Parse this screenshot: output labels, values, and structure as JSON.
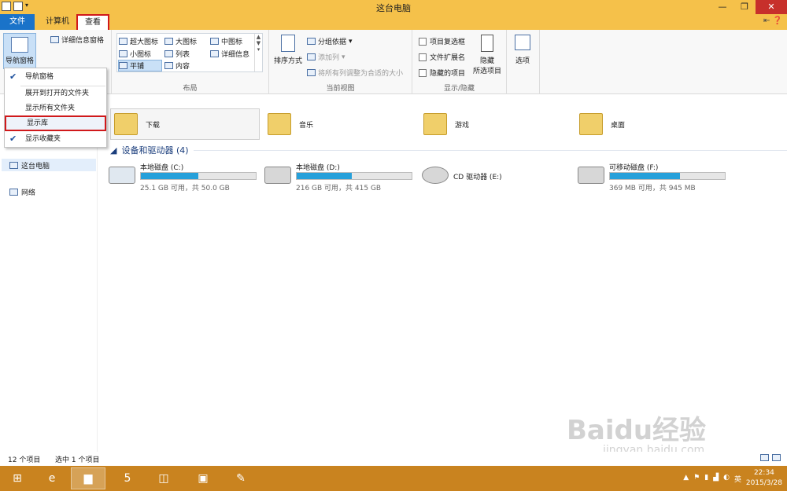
{
  "window": {
    "title": "这台电脑",
    "minimize": "—",
    "maximize": "❐",
    "close": "✕"
  },
  "tabs": {
    "file": "文件",
    "computer": "计算机",
    "view": "查看"
  },
  "ribbon": {
    "nav_pane": "导航窗格",
    "detail_pane": "详细信息窗格",
    "layout": {
      "xl_icons": "超大图标",
      "large_icons": "大图标",
      "medium_icons": "中图标",
      "small_icons": "小图标",
      "list": "列表",
      "details": "详细信息",
      "tiles": "平铺",
      "content": "内容",
      "group_label": "布局"
    },
    "current_view": {
      "sort": "排序方式",
      "group_by": "分组依据",
      "add_column": "添加列",
      "fit_columns": "将所有列调整为合适的大小",
      "group_label": "当前视图"
    },
    "show_hide": {
      "item_checkboxes": "项目复选框",
      "file_ext": "文件扩展名",
      "hidden_items": "隐藏的项目",
      "hide_selected_1": "隐藏",
      "hide_selected_2": "所选项目",
      "group_label": "显示/隐藏"
    },
    "options": "选项"
  },
  "dropdown": {
    "items": [
      "导航窗格",
      "展开到打开的文件夹",
      "显示所有文件夹",
      "显示库",
      "显示收藏夹"
    ]
  },
  "nav": {
    "this_pc": "这台电脑",
    "network": "网络"
  },
  "folders": [
    "下载",
    "音乐",
    "游戏",
    "桌面"
  ],
  "devices": {
    "section": "设备和驱动器 (4)",
    "drives": [
      {
        "name": "本地磁盘 (C:)",
        "space": "25.1 GB 可用，共 50.0 GB",
        "used": 0.5
      },
      {
        "name": "本地磁盘 (D:)",
        "space": "216 GB 可用，共 415 GB",
        "used": 0.48
      },
      {
        "name": "CD 驱动器 (E:)",
        "space": "",
        "used": 0
      },
      {
        "name": "可移动磁盘 (F:)",
        "space": "369 MB 可用，共 945 MB",
        "used": 0.61
      }
    ]
  },
  "status": {
    "count": "12 个项目",
    "selected": "选中 1 个项目"
  },
  "clock": {
    "time": "22:34",
    "date": "2015/3/28"
  },
  "tray_lang": "英",
  "watermark": {
    "main": "Baidu经验",
    "sub": "jingyan.baidu.com"
  }
}
